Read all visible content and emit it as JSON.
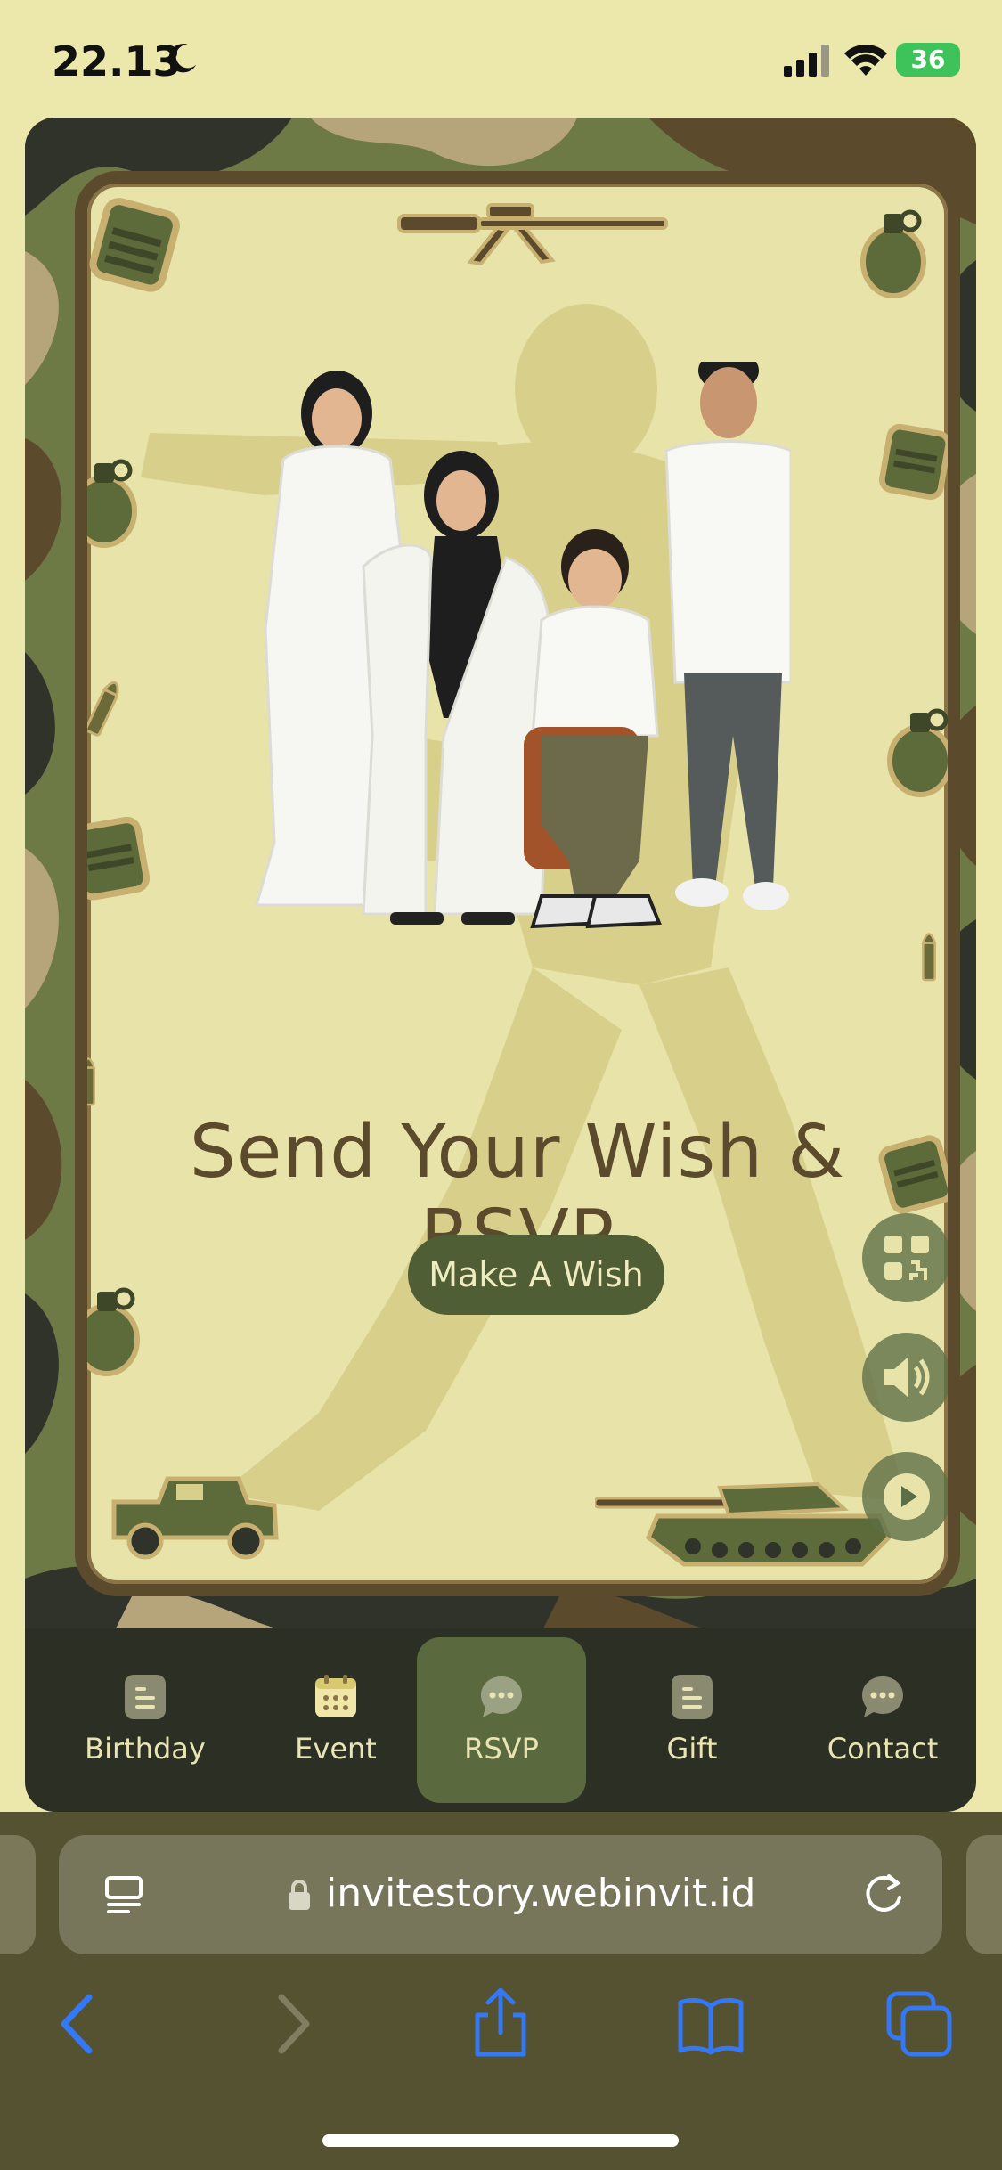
{
  "status_bar": {
    "time": "22.13",
    "battery": "36"
  },
  "card": {
    "heading": "Send Your Wish & RSVP",
    "wish_button": "Make A Wish"
  },
  "bottom_nav": {
    "items": [
      {
        "label": "Birthday",
        "icon": "document-icon"
      },
      {
        "label": "Event",
        "icon": "calendar-icon"
      },
      {
        "label": "RSVP",
        "icon": "chat-icon",
        "active": true
      },
      {
        "label": "Gift",
        "icon": "document-icon"
      },
      {
        "label": "Contact",
        "icon": "chat-icon"
      }
    ]
  },
  "browser": {
    "url": "invitestory.webinvit.id"
  },
  "colors": {
    "background": "#ece8ac",
    "card": "#e8e3a8",
    "accent": "#4f5e35",
    "text": "#5b4a2c",
    "nav_bg": "#2b2f24",
    "nav_active": "#5a6a3e",
    "browser_bg": "#545230",
    "link_blue": "#3478f6"
  }
}
